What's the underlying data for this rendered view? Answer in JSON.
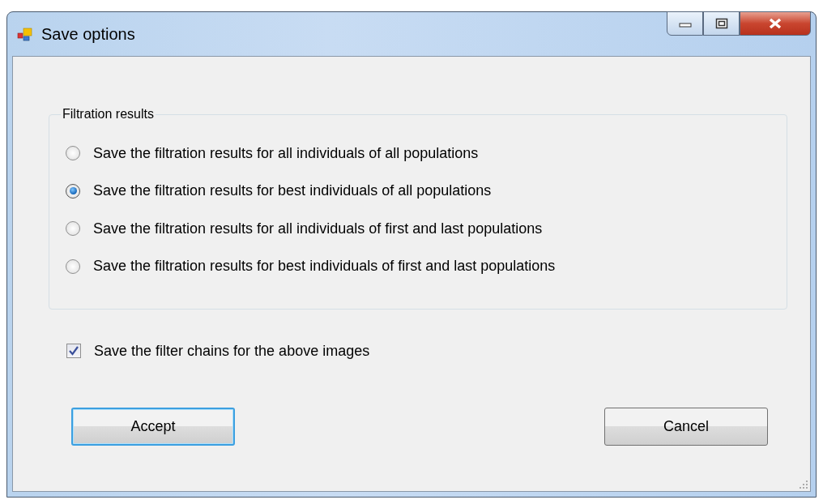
{
  "window": {
    "title": "Save options"
  },
  "group": {
    "title": "Filtration results",
    "options": [
      {
        "label": "Save the filtration results for all individuals of all populations",
        "selected": false
      },
      {
        "label": "Save the filtration results for best individuals of all populations",
        "selected": true
      },
      {
        "label": "Save the filtration results for all individuals of first and last populations",
        "selected": false
      },
      {
        "label": "Save the filtration results for best individuals of first and last populations",
        "selected": false
      }
    ]
  },
  "checkbox": {
    "label": "Save the filter chains for the above images",
    "checked": true
  },
  "buttons": [
    {
      "label": "Accept",
      "default": true
    },
    {
      "label": "Cancel",
      "default": false
    }
  ]
}
